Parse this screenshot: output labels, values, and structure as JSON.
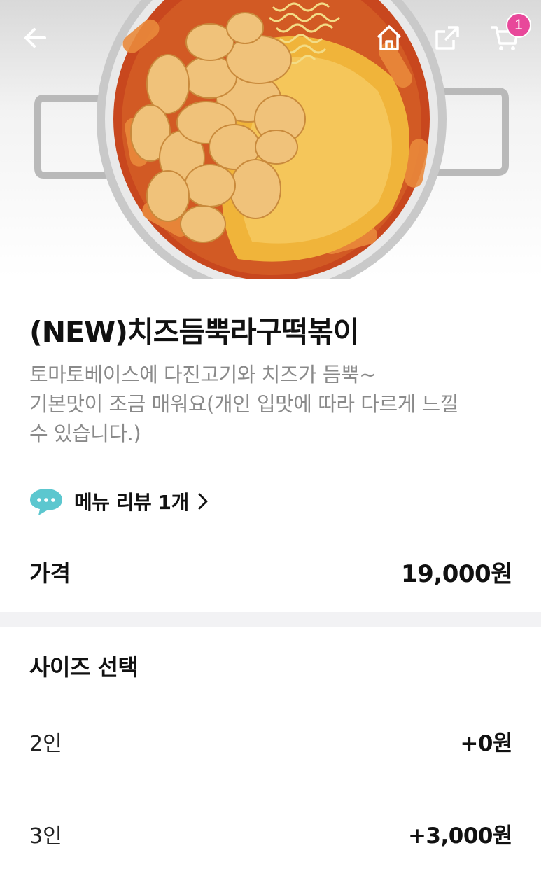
{
  "header": {
    "back_icon": "arrow-left-icon",
    "home_icon": "home-icon",
    "share_icon": "share-icon",
    "cart_icon": "cart-icon",
    "cart_count": "1",
    "badge_color": "#e8489a"
  },
  "product": {
    "title": "(NEW)치즈듬뿍라구떡볶이",
    "description_lines": [
      "토마토베이스에 다진고기와 치즈가 듬뿍~",
      "기본맛이 조금 매워요(개인 입맛에 따라 다르게 느낄",
      "수 있습니다.)"
    ],
    "review_icon": "speech-bubble-icon",
    "review_label": "메뉴 리뷰 1개"
  },
  "price": {
    "label": "가격",
    "value": "19,000원"
  },
  "size_section": {
    "title": "사이즈 선택",
    "options": [
      {
        "name": "2인",
        "price": "+0원"
      },
      {
        "name": "3인",
        "price": "+3,000원"
      }
    ]
  },
  "colors": {
    "accent": "#e8489a",
    "divider": "#f2f2f4",
    "muted_text": "#8a8a8a"
  }
}
